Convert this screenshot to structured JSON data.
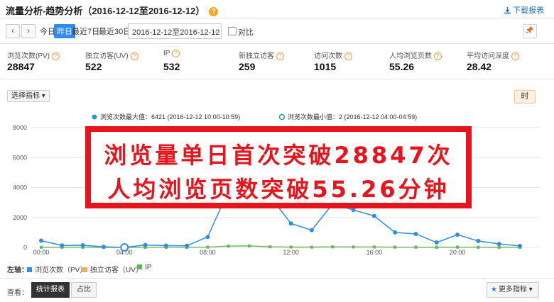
{
  "header": {
    "title": "流量分析-趋势分析（2016-12-12至2016-12-12）",
    "help_icon": "?",
    "download_label": "下载报表"
  },
  "toolbar": {
    "prev": "‹",
    "next": "›",
    "ranges": [
      "今日",
      "昨日",
      "最近7日",
      "最近30日"
    ],
    "date_value": "2016-12-12至2016-12-12",
    "compare_label": "对比"
  },
  "metrics": [
    {
      "label": "浏览次数(PV)",
      "value": "28847"
    },
    {
      "label": "独立访客(UV)",
      "value": "522"
    },
    {
      "label": "IP",
      "value": "532"
    },
    {
      "label": "新独立访客",
      "value": "259"
    },
    {
      "label": "访问次数",
      "value": "1015"
    },
    {
      "label": "人均浏览页数",
      "value": "55.26"
    },
    {
      "label": "平均访问深度",
      "value": "28.42"
    }
  ],
  "chart_controls": {
    "indicator_select": "选择指标",
    "hour_button": "时"
  },
  "chart_legend": {
    "max": "浏览次数最大值：6421 (2016-12-12 10:00-10:59)",
    "min": "浏览次数最小值：2 (2016-12-12 04:00-04:59)"
  },
  "banner": {
    "line1": "浏览量单日首次突破28847次",
    "line2": "人均浏览页数突破55.26分钟"
  },
  "colors": {
    "pv": "#2f8ee0",
    "uv": "#f0ad4e",
    "ip": "#5cb85c",
    "banner_red": "#e8141c",
    "accent_blue": "#2d8cf0"
  },
  "chart_data": {
    "type": "line",
    "x": [
      0,
      1,
      2,
      3,
      4,
      5,
      6,
      7,
      8,
      9,
      10,
      11,
      12,
      13,
      14,
      15,
      16,
      17,
      18,
      19,
      20,
      21,
      22,
      23
    ],
    "x_ticks": [
      "00:00",
      "04:00",
      "08:00",
      "12:00",
      "16:00",
      "20:00"
    ],
    "y_ticks": [
      "0",
      "2000",
      "4000",
      "6000",
      "8000"
    ],
    "ylim": [
      0,
      8000
    ],
    "series": [
      {
        "name": "浏览次数（PV）",
        "color": "#2f8ee0",
        "values": [
          450,
          130,
          140,
          40,
          2,
          160,
          120,
          110,
          700,
          3800,
          6421,
          3400,
          1600,
          1150,
          2900,
          2500,
          2100,
          1000,
          900,
          330,
          850,
          430,
          230,
          100
        ]
      },
      {
        "name": "独立访客（UV）",
        "color": "#f0ad4e",
        "values": [
          10,
          6,
          6,
          3,
          2,
          6,
          6,
          6,
          18,
          90,
          100,
          40,
          25,
          20,
          35,
          30,
          28,
          18,
          16,
          10,
          18,
          12,
          8,
          5
        ]
      },
      {
        "name": "IP",
        "color": "#5cb85c",
        "values": [
          10,
          6,
          6,
          3,
          2,
          6,
          6,
          6,
          18,
          90,
          100,
          40,
          25,
          20,
          35,
          30,
          28,
          18,
          16,
          10,
          18,
          12,
          8,
          5
        ]
      }
    ],
    "legend": [
      "浏览次数（PV）",
      "独立访客（UV）",
      "IP"
    ],
    "axis_label": "左轴："
  },
  "view": {
    "label": "查看：",
    "tabs": [
      "统计报表",
      "占比"
    ],
    "more_label": "更多指标"
  }
}
